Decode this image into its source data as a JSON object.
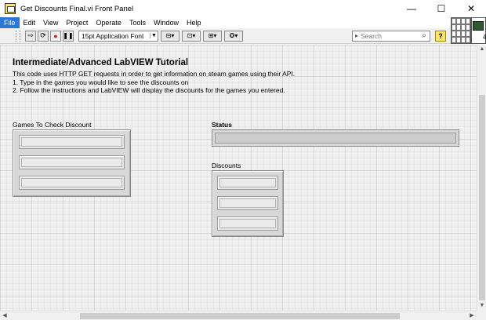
{
  "window": {
    "title": "Get Discounts Final.vi Front Panel",
    "minimize": "—",
    "maximize": "☐",
    "close": "✕"
  },
  "menu": {
    "items": [
      "File",
      "Edit",
      "View",
      "Project",
      "Operate",
      "Tools",
      "Window",
      "Help"
    ],
    "active_index": 0
  },
  "toolbar": {
    "font": "15pt Application Font",
    "search_placeholder": "Search",
    "help_label": "?",
    "connector_number": "4"
  },
  "panel": {
    "heading": "Intermediate/Advanced LabVIEW Tutorial",
    "description": [
      "This code uses HTTP GET requests in order to get information on steam games using their API.",
      "1. Type in the games you would like to see the discounts on",
      "2. Follow the instructions and LabVIEW will display the discounts for the games you entered."
    ],
    "games_label": "Games To Check Discount",
    "status_label": "Status",
    "discounts_label": "Discounts",
    "status_value": "",
    "games": [
      "",
      "",
      ""
    ],
    "discounts": [
      "",
      "",
      ""
    ]
  },
  "colors": {
    "menu_active": "#2b78d4",
    "panel_bg": "#f0f0f0",
    "control_bg": "#d8d8d8"
  }
}
